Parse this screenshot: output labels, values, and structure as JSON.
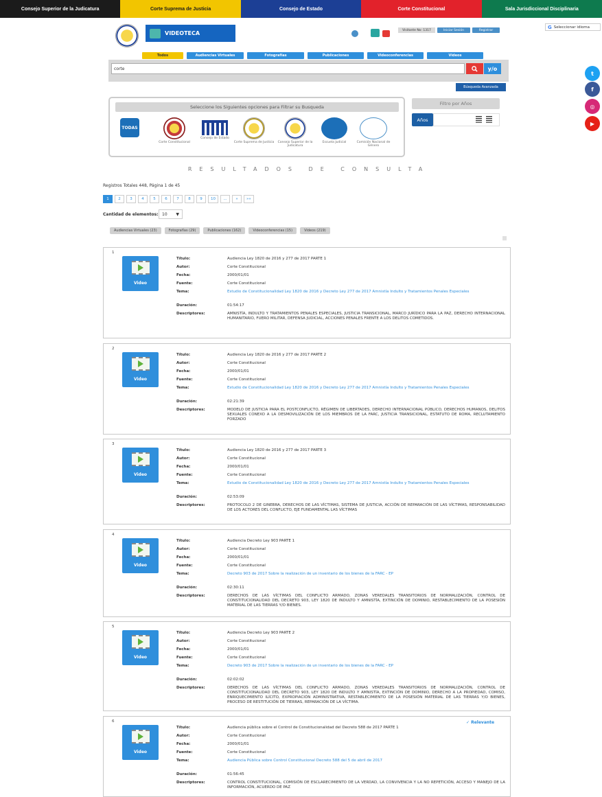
{
  "topbar": [
    {
      "label": "Consejo Superior de la Judicatura",
      "bg": "#1b1b1b",
      "fg": "#ffffff"
    },
    {
      "label": "Corte Suprema de Justicia",
      "bg": "#f2c500",
      "fg": "#1b1b1b"
    },
    {
      "label": "Consejo de Estado",
      "bg": "#1c3f95",
      "fg": "#ffffff"
    },
    {
      "label": "Corte Constitucional",
      "bg": "#e2222b",
      "fg": "#ffffff"
    },
    {
      "label": "Sala Jurisdiccional Disciplinaria",
      "bg": "#0e7a4e",
      "fg": "#ffffff"
    }
  ],
  "header": {
    "banner": "VIDEOTECA",
    "visit_counter": "Visitante No: 1317",
    "login": "Iniciar Sesión",
    "register": "Registrar",
    "language": "Seleccionar idioma"
  },
  "tabs": [
    "Todos",
    "Audiencias Virtuales",
    "Fotografías",
    "Publicaciones",
    "Videoconferencias",
    "Videos"
  ],
  "search": {
    "value": "corte",
    "yo_label": "y/o",
    "advanced": "Búsqueda Avanzada"
  },
  "filter": {
    "title": "Seleccione los Siguientes opciones para Filtrar su Busqueda",
    "todas": "TODAS",
    "entities": [
      "Corte Constitucional",
      "Consejo de Estado",
      "Corte Suprema de Justicia",
      "Consejo Superior de la Judicatura",
      "Escuela Judicial",
      "Comisión Nacional de Género"
    ]
  },
  "years": {
    "title": "Filtro por Años",
    "button": "Años"
  },
  "results": {
    "title": "RESULTADOS DE CONSULTA",
    "totals": "Registros Totales 448, Página 1 de 45",
    "pages": [
      "1",
      "2",
      "3",
      "4",
      "5",
      "6",
      "7",
      "8",
      "9",
      "10",
      "...",
      "»",
      "»»"
    ],
    "quantity_label": "Cantidad de elementos:",
    "quantity_value": "10",
    "categories": [
      "Audiencias Virtuales (23)",
      "Fotografías (29)",
      "Publicaciones (162)",
      "Videoconferencias (15)",
      "Videos (219)"
    ]
  },
  "labels": {
    "titulo": "Título:",
    "autor": "Autor:",
    "fecha": "Fecha:",
    "fuente": "Fuente:",
    "tema": "Tema:",
    "duracion": "Duración:",
    "descriptores": "Descriptores:",
    "video": "Video",
    "relevante": "✓ Relevante"
  },
  "items": [
    {
      "num": "1",
      "titulo": "Audiencia Ley 1820 de 2016 y 277 de 2017 PARTE 1",
      "autor": "Corte Constitucional",
      "fecha": "2000/01/01",
      "fuente": "Corte Constitucional",
      "tema": "Estudio de Constitucionalidad Ley 1820 de 2016 y Decreto Ley 277 de 2017 Amnistía Indulto y Tratamientos Penales Especiales",
      "duracion": "01:54:17",
      "descriptores": "AMNISTÍA, INDULTO Y TRATAMIENTOS PENALES ESPECIALES, JUSTICIA TRANSICIONAL, MARCO JURÍDICO PARA LA PAZ, DERECHO INTERNACIONAL HUMANITARIO, FUERO MILITAR, DEFENSA JUDICIAL, ACCIONES PENALES FRENTE A LOS DELITOS COMETIDOS."
    },
    {
      "num": "2",
      "titulo": "Audiencia Ley 1820 de 2016 y 277 de 2017 PARTE 2",
      "autor": "Corte Constitucional",
      "fecha": "2000/01/01",
      "fuente": "Corte Constitucional",
      "tema": "Estudio de Constitucionalidad Ley 1820 de 2016 y Decreto Ley 277 de 2017 Amnistía Indulto y Tratamientos Penales Especiales",
      "duracion": "02:21:39",
      "descriptores": "MODELO DE JUSTICIA PARA EL POSTCONFLICTO, RÉGIMEN DE LIBERTADES, DERECHO INTERNACIONAL PÚBLICO, DERECHOS HUMANOS, DELITOS SEXUALES CONEXO A LA DESMOVILIZACIÓN DE LOS MIEMBROS DE LA FARC, JUSTICIA TRANSICIONAL, ESTATUTO DE ROMA, RECLUTAMIENTO FORZADO"
    },
    {
      "num": "3",
      "titulo": "Audiencia Ley 1820 de 2016 y 277 de 2017 PARTE 3",
      "autor": "Corte Constitucional",
      "fecha": "2000/01/01",
      "fuente": "Corte Constitucional",
      "tema": "Estudio de Constitucionalidad Ley 1820 de 2016 y Decreto Ley 277 de 2017 Amnistía Indulto y Tratamientos Penales Especiales",
      "duracion": "02:53:09",
      "descriptores": "PROTOCOLO 2 DE GINEBRA, DERECHOS DE LAS VÍCTIMAS, SISTEMA DE JUSTICIA, ACCIÓN DE REPARACIÓN DE LAS VÍCTIMAS, RESPONSABILIDAD DE LOS ACTORES DEL CONFLICTO, EJE FUNDAMENTAL LAS VÍCTIMAS"
    },
    {
      "num": "4",
      "titulo": "Audiencia Decreto Ley 903 PARTE 1",
      "autor": "Corte Constitucional",
      "fecha": "2000/01/01",
      "fuente": "Corte Constitucional",
      "tema": "Decreto 903 de 2017 Sobre la realización de un inventario de los bienes de la FARC - EP",
      "duracion": "02:30:11",
      "descriptores": "DERECHOS DE LAS VÍCTIMAS DEL CONFLICTO ARMADO, ZONAS VEREDALES TRANSITORIOS DE NORMALIZACIÓN, CONTROL DE CONSTITUCIONALIDAD DEL DECRETO 903, LEY 1820 DE INDULTO Y AMNISTÍA, EXTINCIÓN DE DOMINIO, RESTABLECIMIENTO DE LA POSESIÓN MATERIAL DE LAS TIERRAS Y/O BIENES."
    },
    {
      "num": "5",
      "titulo": "Audiencia Decreto Ley 903 PARTE 2",
      "autor": "Corte Constitucional",
      "fecha": "2000/01/01",
      "fuente": "Corte Constitucional",
      "tema": "Decreto 903 de 2017 Sobre la realización de un inventario de los bienes de la FARC - EP",
      "duracion": "02:02:02",
      "descriptores": "DERECHOS DE LAS VÍCTIMAS DEL CONFLICTO ARMADO, ZONAS VEREDALES TRANSITORIOS DE NORMALIZACIÓN, CONTROL DE CONSTITUCIONALIDAD DEL DECRETO 903, LEY 1820 DE INDULTO Y AMNISTÍA, EXTINCIÓN DE DOMINIO, DERECHO A LA PROPIEDAD, COMISO, ENRIQUECIMIENTO ILÍCITO, EXPROPIACIÓN ADMINISTRATIVA, RESTABLECIMIENTO DE LA POSESIÓN MATERIAL DE LAS TIERRAS Y/O BIENES, PROCESO DE RESTITUCIÓN DE TIERRAS, REPARACIÓN DE LA VÍCTIMA."
    },
    {
      "num": "6",
      "relevante": true,
      "titulo": "Audiencia pública sobre el Control de Constitucionalidad del Decreto 588 de 2017 PARTE 1",
      "autor": "Corte Constitucional",
      "fecha": "2000/01/01",
      "fuente": "Corte Constitucional",
      "tema": "Audiencia Pública sobre Control Constitucional Decreto 588 del 5 de abril de 2017",
      "duracion": "01:56:45",
      "descriptores": "CONTROL CONSTITUCIONAL, COMISIÓN DE ESCLARECIMIENTO DE LA VERDAD, LA CONVIVENCIA Y LA NO REPETICIÓN, ACCESO Y MANEJO DE LA INFORMACIÓN, ACUERDO DE PAZ"
    }
  ],
  "social": [
    "twitter",
    "facebook",
    "instagram",
    "youtube"
  ]
}
